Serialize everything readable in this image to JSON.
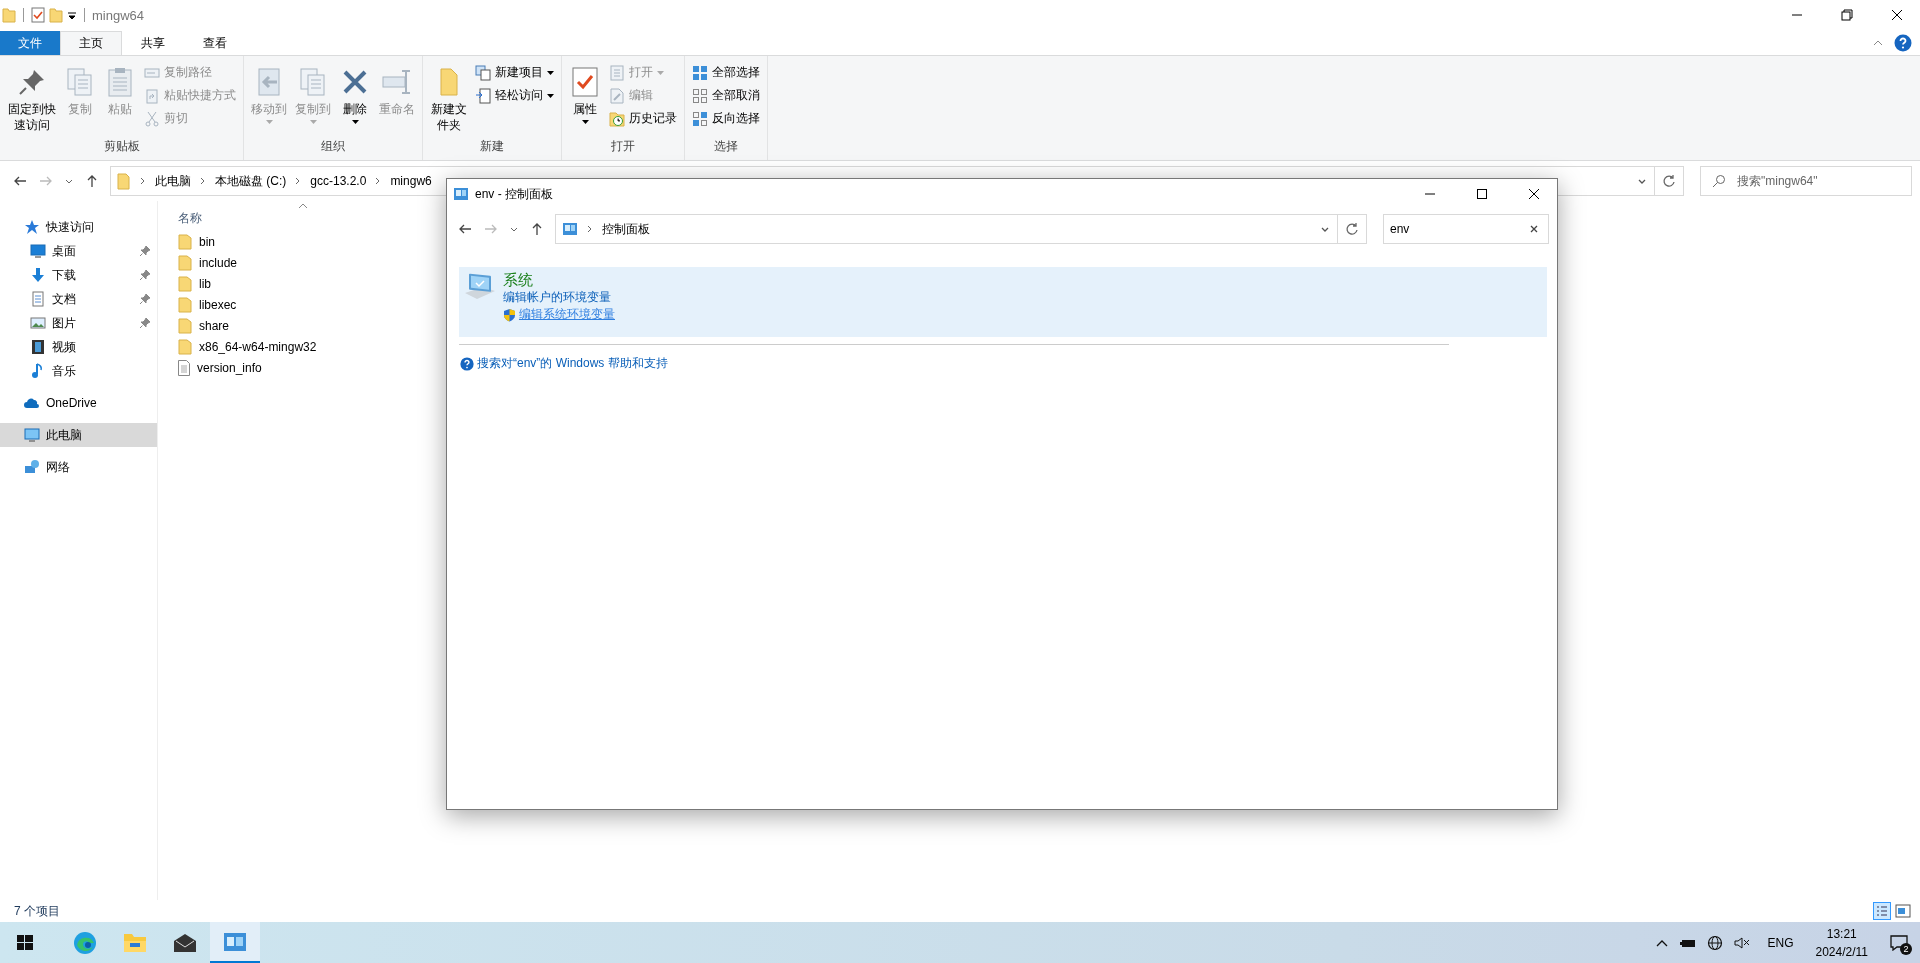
{
  "explorer": {
    "title": "mingw64",
    "ribbon_tabs": [
      {
        "label": "文件",
        "kind": "file",
        "selected": false
      },
      {
        "label": "主页",
        "kind": "tab",
        "selected": true
      },
      {
        "label": "共享",
        "kind": "tab",
        "selected": false
      },
      {
        "label": "查看",
        "kind": "tab",
        "selected": false
      }
    ],
    "ribbon_groups": [
      {
        "label": "剪贴板",
        "items": [
          {
            "label": "固定到快速访问",
            "kind": "large",
            "disabled": false,
            "dropdown": false
          },
          {
            "label": "复制",
            "kind": "large",
            "disabled": true,
            "dropdown": false
          },
          {
            "label": "粘贴",
            "kind": "large",
            "disabled": true,
            "dropdown": false
          },
          {
            "label": "复制路径",
            "kind": "small",
            "disabled": true,
            "dropdown": false
          },
          {
            "label": "粘贴快捷方式",
            "kind": "small",
            "disabled": true,
            "dropdown": false
          },
          {
            "label": "剪切",
            "kind": "small",
            "disabled": true,
            "dropdown": false
          }
        ]
      },
      {
        "label": "组织",
        "items": [
          {
            "label": "移动到",
            "kind": "large",
            "disabled": true,
            "dropdown": true
          },
          {
            "label": "复制到",
            "kind": "large",
            "disabled": true,
            "dropdown": true
          },
          {
            "label": "删除",
            "kind": "large",
            "disabled": false,
            "dropdown": true
          },
          {
            "label": "重命名",
            "kind": "large",
            "disabled": true,
            "dropdown": false
          }
        ]
      },
      {
        "label": "新建",
        "items": [
          {
            "label": "新建文件夹",
            "kind": "large",
            "disabled": false,
            "dropdown": false
          },
          {
            "label": "新建项目",
            "kind": "small",
            "disabled": false,
            "dropdown": true
          },
          {
            "label": "轻松访问",
            "kind": "small",
            "disabled": false,
            "dropdown": true
          }
        ]
      },
      {
        "label": "打开",
        "items": [
          {
            "label": "属性",
            "kind": "large",
            "disabled": false,
            "dropdown": true
          },
          {
            "label": "打开",
            "kind": "small",
            "disabled": true,
            "dropdown": true
          },
          {
            "label": "编辑",
            "kind": "small",
            "disabled": true,
            "dropdown": false
          },
          {
            "label": "历史记录",
            "kind": "small",
            "disabled": false,
            "dropdown": false
          }
        ]
      },
      {
        "label": "选择",
        "items": [
          {
            "label": "全部选择",
            "kind": "small",
            "disabled": false,
            "dropdown": false
          },
          {
            "label": "全部取消",
            "kind": "small",
            "disabled": false,
            "dropdown": false
          },
          {
            "label": "反向选择",
            "kind": "small",
            "disabled": false,
            "dropdown": false
          }
        ]
      }
    ],
    "address": {
      "crumbs": [
        "此电脑",
        "本地磁盘 (C:)",
        "gcc-13.2.0",
        "mingw6"
      ]
    },
    "search": {
      "placeholder": "搜索\"mingw64\""
    },
    "nav": [
      {
        "label": "快速访问",
        "selected": false,
        "children": [
          {
            "label": "桌面",
            "pinned": true,
            "selected": false
          },
          {
            "label": "下载",
            "pinned": true,
            "selected": false
          },
          {
            "label": "文档",
            "pinned": true,
            "selected": false
          },
          {
            "label": "图片",
            "pinned": true,
            "selected": false
          },
          {
            "label": "视频",
            "pinned": false,
            "selected": false
          },
          {
            "label": "音乐",
            "pinned": false,
            "selected": false
          }
        ]
      },
      {
        "label": "OneDrive",
        "selected": false
      },
      {
        "label": "此电脑",
        "selected": true
      },
      {
        "label": "网络",
        "selected": false
      }
    ],
    "column": "名称",
    "files": [
      {
        "name": "bin",
        "kind": "folder"
      },
      {
        "name": "include",
        "kind": "folder"
      },
      {
        "name": "lib",
        "kind": "folder"
      },
      {
        "name": "libexec",
        "kind": "folder"
      },
      {
        "name": "share",
        "kind": "folder"
      },
      {
        "name": "x86_64-w64-mingw32",
        "kind": "folder"
      },
      {
        "name": "version_info",
        "kind": "file"
      }
    ],
    "status": "7 个项目"
  },
  "dialog": {
    "title": "env - 控制面板",
    "crumb": "控制面板",
    "search": {
      "value": "env"
    },
    "result": {
      "title": "系统",
      "links": [
        {
          "label": "编辑帐户的环境变量",
          "shield": false,
          "hovered": false
        },
        {
          "label": "编辑系统环境变量",
          "shield": true,
          "hovered": true
        }
      ]
    },
    "help": "搜索对“env”的 Windows 帮助和支持"
  },
  "taskbar": {
    "apps": [
      {
        "kind": "edge",
        "active": false
      },
      {
        "kind": "explorer",
        "active": false
      },
      {
        "kind": "mail",
        "active": false
      },
      {
        "kind": "control",
        "active": true
      }
    ],
    "lang": "ENG",
    "time": "13:21",
    "date": "2024/2/11",
    "notifications": "2"
  }
}
